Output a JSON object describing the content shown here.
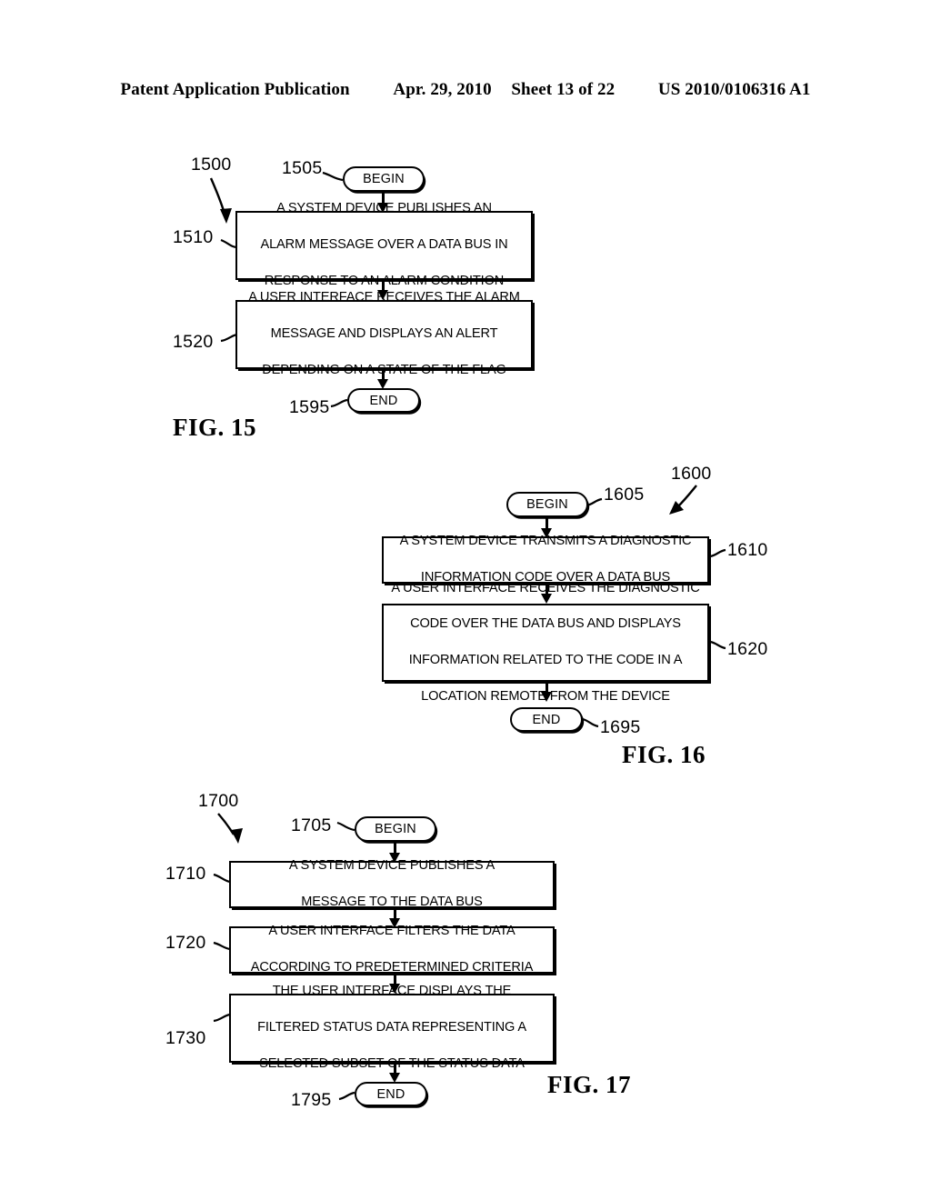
{
  "header": {
    "publication": "Patent Application Publication",
    "date": "Apr. 29, 2010",
    "sheet": "Sheet 13 of 22",
    "docnum": "US 2010/0106316 A1"
  },
  "figures": [
    {
      "caption": "FIG. 15",
      "flow_ref": "1500",
      "nodes": [
        {
          "ref": "1505",
          "type": "terminator",
          "label": "BEGIN"
        },
        {
          "ref": "1510",
          "type": "process",
          "lines": [
            "A SYSTEM DEVICE PUBLISHES AN",
            "ALARM MESSAGE OVER A DATA BUS IN",
            "RESPONSE TO AN ALARM CONDITION"
          ]
        },
        {
          "ref": "1520",
          "type": "process",
          "lines": [
            "A USER INTERFACE RECEIVES THE ALARM",
            "MESSAGE AND DISPLAYS AN ALERT",
            "DEPENDING ON A STATE OF THE FLAG"
          ]
        },
        {
          "ref": "1595",
          "type": "terminator",
          "label": "END"
        }
      ]
    },
    {
      "caption": "FIG. 16",
      "flow_ref": "1600",
      "nodes": [
        {
          "ref": "1605",
          "type": "terminator",
          "label": "BEGIN"
        },
        {
          "ref": "1610",
          "type": "process",
          "lines": [
            "A SYSTEM DEVICE TRANSMITS A DIAGNOSTIC",
            "INFORMATION CODE OVER A DATA BUS"
          ]
        },
        {
          "ref": "1620",
          "type": "process",
          "lines": [
            "A USER INTERFACE RECEIVES THE DIAGNOSTIC",
            "CODE OVER THE DATA BUS AND DISPLAYS",
            "INFORMATION RELATED TO THE CODE IN A",
            "LOCATION REMOTE FROM THE DEVICE"
          ]
        },
        {
          "ref": "1695",
          "type": "terminator",
          "label": "END"
        }
      ]
    },
    {
      "caption": "FIG. 17",
      "flow_ref": "1700",
      "nodes": [
        {
          "ref": "1705",
          "type": "terminator",
          "label": "BEGIN"
        },
        {
          "ref": "1710",
          "type": "process",
          "lines": [
            "A SYSTEM DEVICE PUBLISHES A",
            "MESSAGE TO THE DATA BUS"
          ]
        },
        {
          "ref": "1720",
          "type": "process",
          "lines": [
            "A USER INTERFACE FILTERS THE DATA",
            "ACCORDING TO PREDETERMINED CRITERIA"
          ]
        },
        {
          "ref": "1730",
          "type": "process",
          "lines": [
            "THE USER INTERFACE DISPLAYS THE",
            "FILTERED STATUS DATA REPRESENTING A",
            "SELECTED SUBSET OF THE STATUS DATA"
          ]
        },
        {
          "ref": "1795",
          "type": "terminator",
          "label": "END"
        }
      ]
    }
  ]
}
